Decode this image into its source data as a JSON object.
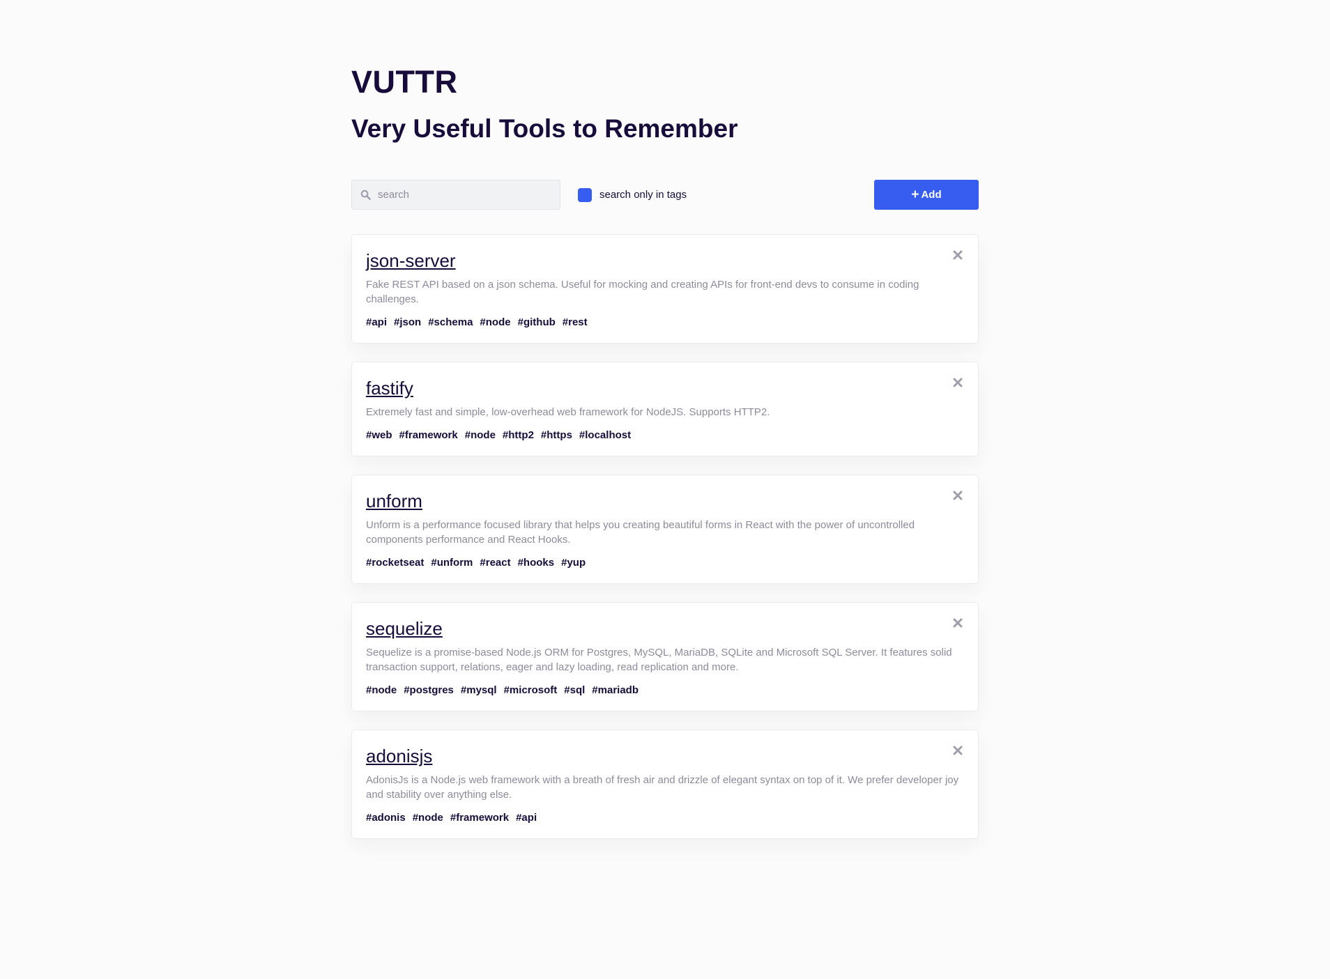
{
  "header": {
    "title": "VUTTR",
    "subtitle": "Very Useful Tools to Remember"
  },
  "toolbar": {
    "search_placeholder": "search",
    "search_value": "",
    "tags_only_label": "search only in tags",
    "tags_only_checked": true,
    "add_label": "Add"
  },
  "colors": {
    "accent": "#365df0",
    "text_dark": "#170c3a",
    "text_muted": "#8f8a9b",
    "icon_muted": "#a09cac"
  },
  "tools": [
    {
      "name": "json-server",
      "description": "Fake REST API based on a json schema. Useful for mocking and creating APIs for front-end devs to consume in coding challenges.",
      "tags": [
        "#api",
        "#json",
        "#schema",
        "#node",
        "#github",
        "#rest"
      ]
    },
    {
      "name": "fastify",
      "description": "Extremely fast and simple, low-overhead web framework for NodeJS. Supports HTTP2.",
      "tags": [
        "#web",
        "#framework",
        "#node",
        "#http2",
        "#https",
        "#localhost"
      ]
    },
    {
      "name": "unform",
      "description": "Unform is a performance focused library that helps you creating beautiful forms in React with the power of uncontrolled components performance and React Hooks.",
      "tags": [
        "#rocketseat",
        "#unform",
        "#react",
        "#hooks",
        "#yup"
      ]
    },
    {
      "name": "sequelize",
      "description": "Sequelize is a promise-based Node.js ORM for Postgres, MySQL, MariaDB, SQLite and Microsoft SQL Server. It features solid transaction support, relations, eager and lazy loading, read replication and more.",
      "tags": [
        "#node",
        "#postgres",
        "#mysql",
        "#microsoft",
        "#sql",
        "#mariadb"
      ]
    },
    {
      "name": "adonisjs",
      "description": "AdonisJs is a Node.js web framework with a breath of fresh air and drizzle of elegant syntax on top of it. We prefer developer joy and stability over anything else.",
      "tags": [
        "#adonis",
        "#node",
        "#framework",
        "#api"
      ]
    }
  ]
}
